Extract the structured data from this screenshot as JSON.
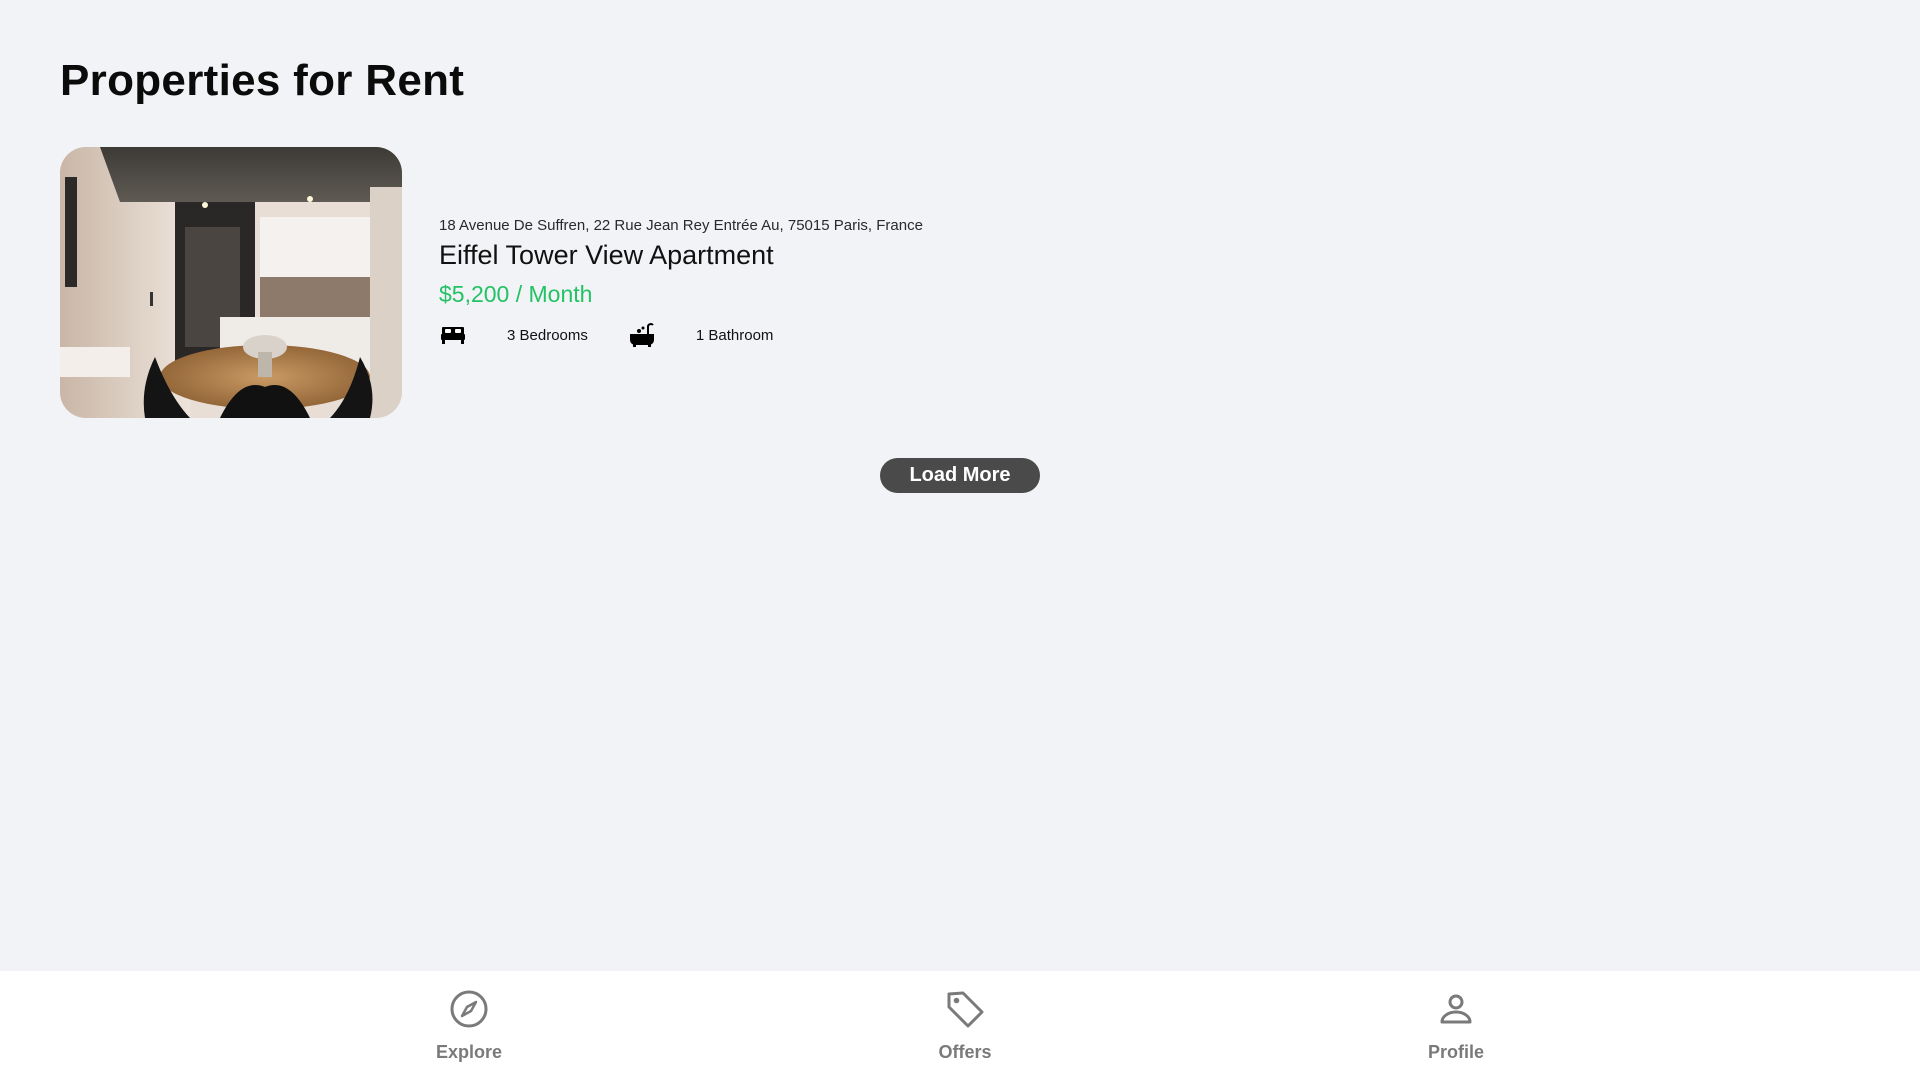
{
  "page": {
    "title": "Properties for Rent"
  },
  "listing": {
    "address": "18 Avenue De Suffren, 22 Rue Jean Rey Entrée Au, 75015 Paris, France",
    "name": "Eiffel Tower View Apartment",
    "price": "$5,200 / Month",
    "price_color": "#23c264",
    "bedrooms_label": "3 Bedrooms",
    "bathrooms_label": "1 Bathroom",
    "bed_icon": "bed-icon",
    "bath_icon": "bathtub-icon"
  },
  "actions": {
    "load_more": "Load More"
  },
  "nav": {
    "items": [
      {
        "label": "Explore",
        "icon": "compass-icon"
      },
      {
        "label": "Offers",
        "icon": "tag-icon"
      },
      {
        "label": "Profile",
        "icon": "user-icon"
      }
    ]
  },
  "colors": {
    "background": "#f2f3f7",
    "button": "#4a4a4a",
    "nav_label": "#7a7a7a"
  }
}
